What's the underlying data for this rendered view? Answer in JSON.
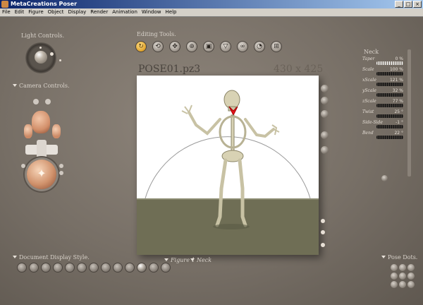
{
  "window": {
    "title": "MetaCreations Poser"
  },
  "menu": [
    "File",
    "Edit",
    "Figure",
    "Object",
    "Display",
    "Render",
    "Animation",
    "Window",
    "Help"
  ],
  "light_controls": {
    "label": "Light Controls."
  },
  "camera_controls": {
    "label": "Camera Controls."
  },
  "editing_tools": {
    "label": "Editing Tools.",
    "tools": [
      {
        "icon": "rotate-icon",
        "glyph": "↻",
        "active": true
      },
      {
        "icon": "twist-icon",
        "glyph": "⟲"
      },
      {
        "icon": "translate-icon",
        "glyph": "✥"
      },
      {
        "icon": "translate-in-out-icon",
        "glyph": "⊕"
      },
      {
        "icon": "scale-icon",
        "glyph": "▣"
      },
      {
        "icon": "taper-icon",
        "glyph": "▽"
      },
      {
        "icon": "chain-break-icon",
        "glyph": "∞"
      },
      {
        "icon": "color-icon",
        "glyph": "◔"
      },
      {
        "icon": "grouping-icon",
        "glyph": "⊞"
      }
    ]
  },
  "document": {
    "title": "POSE01.pz3",
    "size": "430 x 425"
  },
  "parameters": {
    "title": "Neck",
    "rows": [
      {
        "name": "Taper",
        "value": "0 %"
      },
      {
        "name": "Scale",
        "value": "100 %"
      },
      {
        "name": "xScale",
        "value": "121 %"
      },
      {
        "name": "yScale",
        "value": "32 %"
      },
      {
        "name": "zScale",
        "value": "77 %"
      },
      {
        "name": "Twist",
        "value": "25 °"
      },
      {
        "name": "Side-Side",
        "value": "-1 °"
      },
      {
        "name": "Bend",
        "value": "22 °"
      }
    ]
  },
  "document_display_style": {
    "label": "Document Display Style."
  },
  "figure_selector": {
    "label": "Figure 1"
  },
  "part_selector": {
    "label": "Neck"
  },
  "pose_dots": {
    "label": "Pose Dots."
  },
  "colors": {
    "title_start": "#0a246a",
    "title_end": "#a6caf0",
    "active_tool": "#e0a22a",
    "floor": "#6f6e55",
    "highlight": "#e8141e"
  }
}
